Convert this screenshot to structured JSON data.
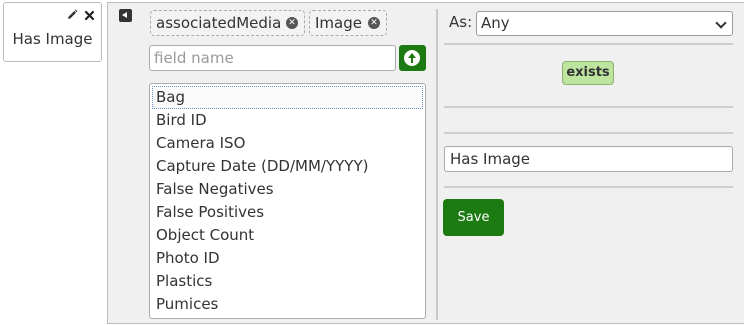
{
  "card": {
    "title": "Has Image",
    "edit_icon": "pencil-icon",
    "close_icon": "close-icon"
  },
  "filter": {
    "collapse_icon": "caret-left-icon",
    "chips": [
      "associatedMedia",
      "Image"
    ],
    "field_placeholder": "field name",
    "add_icon": "arrow-up-circle-icon",
    "options": [
      "Bag",
      "Bird ID",
      "Camera ISO",
      "Capture Date (DD/MM/YYYY)",
      "False Negatives",
      "False Positives",
      "Object Count",
      "Photo ID",
      "Plastics",
      "Pumices"
    ],
    "active_option": "Bag"
  },
  "settings": {
    "as_label": "As:",
    "as_value": "Any",
    "exists_label": "exists",
    "name_value": "Has Image",
    "save_label": "Save"
  },
  "colors": {
    "primary": "#1c7a12",
    "exists_bg": "#bde5a0",
    "panel_bg": "#f0f0f0"
  }
}
